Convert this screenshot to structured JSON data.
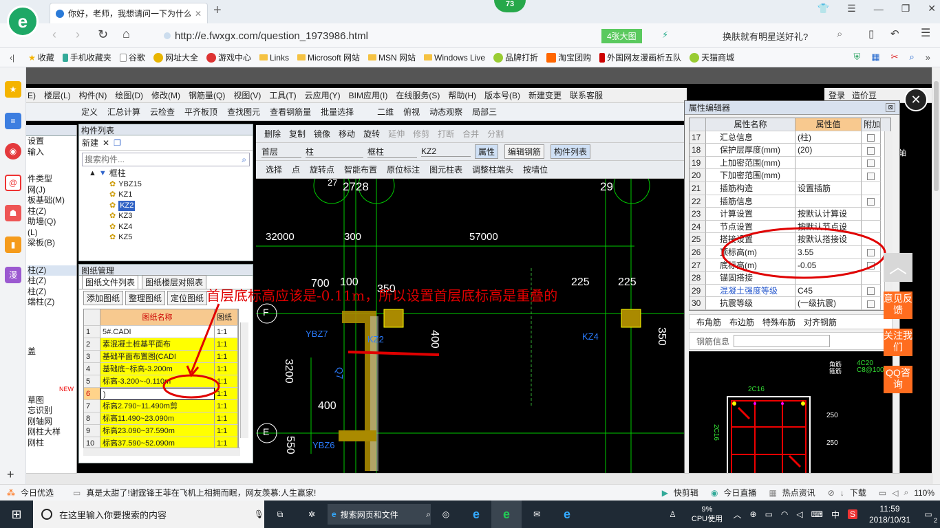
{
  "browser": {
    "tab_title": "你好，老师，我想请问一下为什么",
    "tab_close": "✕",
    "new_tab": "+",
    "url": "http://e.fwxgx.com/question_1973986.html",
    "image_badge": "4张大图",
    "search_hint": "换肤就有明星送好礼?",
    "badge_73": "73"
  },
  "favorites": [
    "收藏",
    "手机收藏夹",
    "谷歌",
    "网址大全",
    "游戏中心",
    "Links",
    "Microsoft 网站",
    "MSN 网站",
    "Windows Live",
    "品牌打折",
    "淘宝团购",
    "外国网友漫画析五队",
    "天猫商城"
  ],
  "gld": {
    "menu": [
      "E)",
      "楼层(L)",
      "构件(N)",
      "绘图(D)",
      "修改(M)",
      "钢筋量(Q)",
      "视图(V)",
      "工具(T)",
      "云应用(Y)",
      "BIM应用(I)",
      "在线服务(S)",
      "帮助(H)",
      "版本号(B)",
      "新建变更",
      "联系客服"
    ],
    "menu_right": [
      "登录",
      "造价豆"
    ],
    "toolbar1": [
      "定义",
      "汇总计算",
      "云检查",
      "平齐板顶",
      "查找图元",
      "查看钢筋量",
      "批量选择",
      "二维",
      "俯视",
      "动态观察",
      "局部三"
    ],
    "toolbar2": [
      "删除",
      "复制",
      "镜像",
      "移动",
      "旋转",
      "延伸",
      "修剪",
      "打断",
      "合并",
      "分割"
    ],
    "toolbar3": {
      "floor": "首层",
      "type": "柱",
      "sub": "框柱",
      "comp": "KZ2",
      "b1": "属性",
      "b2": "编辑钢筋",
      "b3": "构件列表"
    },
    "toolbar4": [
      "选择",
      "点",
      "旋转点",
      "智能布置",
      "原位标注",
      "图元柱表",
      "调整柱端头",
      "按墙位"
    ],
    "left_cut": [
      "设置",
      "输入",
      "件类型",
      "网(J)",
      "板基础(M)",
      "柱(Z)",
      "助墙(Q)",
      "(L)",
      "梁板(B)",
      "柱(Z)",
      "柱(Z)",
      "柱(Z)",
      "端柱(Z)",
      "盖",
      "NEW",
      "草图",
      "忘识别",
      "刚轴网",
      "刚柱大样",
      "刚柱"
    ],
    "comp_list": {
      "title": "构件列表",
      "new": "新建",
      "search_placeholder": "搜索构件...",
      "root": "框柱",
      "items": [
        "YBZ15",
        "KZ1",
        "KZ2",
        "KZ3",
        "KZ4",
        "KZ5"
      ]
    },
    "drawing_mgr": {
      "title": "图纸管理",
      "tabs": [
        "图纸文件列表",
        "图纸楼层对照表"
      ],
      "buttons": [
        "添加图纸",
        "整理图纸",
        "定位图纸"
      ],
      "headers": [
        "图纸名称",
        "图纸"
      ],
      "rows": [
        {
          "n": "1",
          "name": "5#.CADI",
          "s": "1:1"
        },
        {
          "n": "2",
          "name": "素混凝土桩基平面布",
          "s": "1:1"
        },
        {
          "n": "3",
          "name": "基础平面布置图(CADI",
          "s": "1:1"
        },
        {
          "n": "4",
          "name": "基础底~标高-3.200m",
          "s": "1:1"
        },
        {
          "n": "5",
          "name": "标高-3.200~-0.110m",
          "s": "1:1"
        },
        {
          "n": "6",
          "name": ")",
          "s": "1:1"
        },
        {
          "n": "7",
          "name": "标高2.790~11.490m剪",
          "s": "1:1"
        },
        {
          "n": "8",
          "name": "标高11.490~23.090m",
          "s": "1:1"
        },
        {
          "n": "9",
          "name": "标高23.090~37.590m",
          "s": "1:1"
        },
        {
          "n": "10",
          "name": "标高37.590~52.090m",
          "s": "1:1"
        }
      ]
    },
    "cad": {
      "dims": [
        "27",
        "2728",
        "29",
        "32000",
        "300",
        "57000",
        "700",
        "100",
        "350",
        "225",
        "225",
        "100",
        "100",
        "400",
        "350",
        "3200",
        "400",
        "550",
        "Q7"
      ],
      "axes": [
        "F",
        "E"
      ],
      "labels": [
        "YBZ7",
        "KZ2",
        "KZ4",
        "YBZ6"
      ],
      "annotation": "首层底标高应该是-0.11m，所以设置首层底标高是重叠的"
    },
    "props": {
      "title": "属性编辑器",
      "headers": [
        "属性名称",
        "属性值",
        "附加"
      ],
      "rows": [
        {
          "n": "17",
          "name": "汇总信息",
          "val": "(柱)"
        },
        {
          "n": "18",
          "name": "保护层厚度(mm)",
          "val": "(20)"
        },
        {
          "n": "19",
          "name": "上加密范围(mm)",
          "val": ""
        },
        {
          "n": "20",
          "name": "下加密范围(mm)",
          "val": ""
        },
        {
          "n": "21",
          "name": "插筋构造",
          "val": "设置插筋"
        },
        {
          "n": "22",
          "name": "插筋信息",
          "val": ""
        },
        {
          "n": "23",
          "name": "计算设置",
          "val": "按默认计算设"
        },
        {
          "n": "24",
          "name": "节点设置",
          "val": "按默认节点设"
        },
        {
          "n": "25",
          "name": "搭接设置",
          "val": "按默认搭接设"
        },
        {
          "n": "26",
          "name": "顶标高(m)",
          "val": "3.55"
        },
        {
          "n": "27",
          "name": "底标高(m)",
          "val": "-0.05"
        },
        {
          "n": "28",
          "name": "锚固搭接",
          "val": ""
        },
        {
          "n": "29",
          "name": "混凝土强度等级",
          "val": "C45"
        },
        {
          "n": "30",
          "name": "抗震等级",
          "val": "(一级抗震)"
        }
      ],
      "rebar_tabs": [
        "布角筋",
        "布边筋",
        "特殊布筋",
        "对齐钢筋"
      ],
      "rebar_info_label": "钢筋信息",
      "section_labels": [
        "角筋",
        "箍筋",
        "4C20",
        "C8@100",
        "2C16",
        "2C16",
        "250",
        "250",
        "250"
      ]
    },
    "right_tools": "轴"
  },
  "site_side": [
    "意见反馈",
    "关注我们",
    "QQ咨询"
  ],
  "status": {
    "left": "今日优选",
    "news": "真是太甜了!谢霆锋王菲在飞机上相拥而眠，网友羡慕:人生赢家!",
    "items": [
      "快剪辑",
      "今日直播",
      "热点资讯",
      "下载"
    ],
    "zoom": "110%"
  },
  "taskbar": {
    "search": "在这里输入你要搜索的内容",
    "browser_search": "搜索网页和文件",
    "cpu": "9%",
    "cpu_label": "CPU使用",
    "ime": "中",
    "time": "11:59",
    "date": "2018/10/31",
    "notif": "2"
  }
}
